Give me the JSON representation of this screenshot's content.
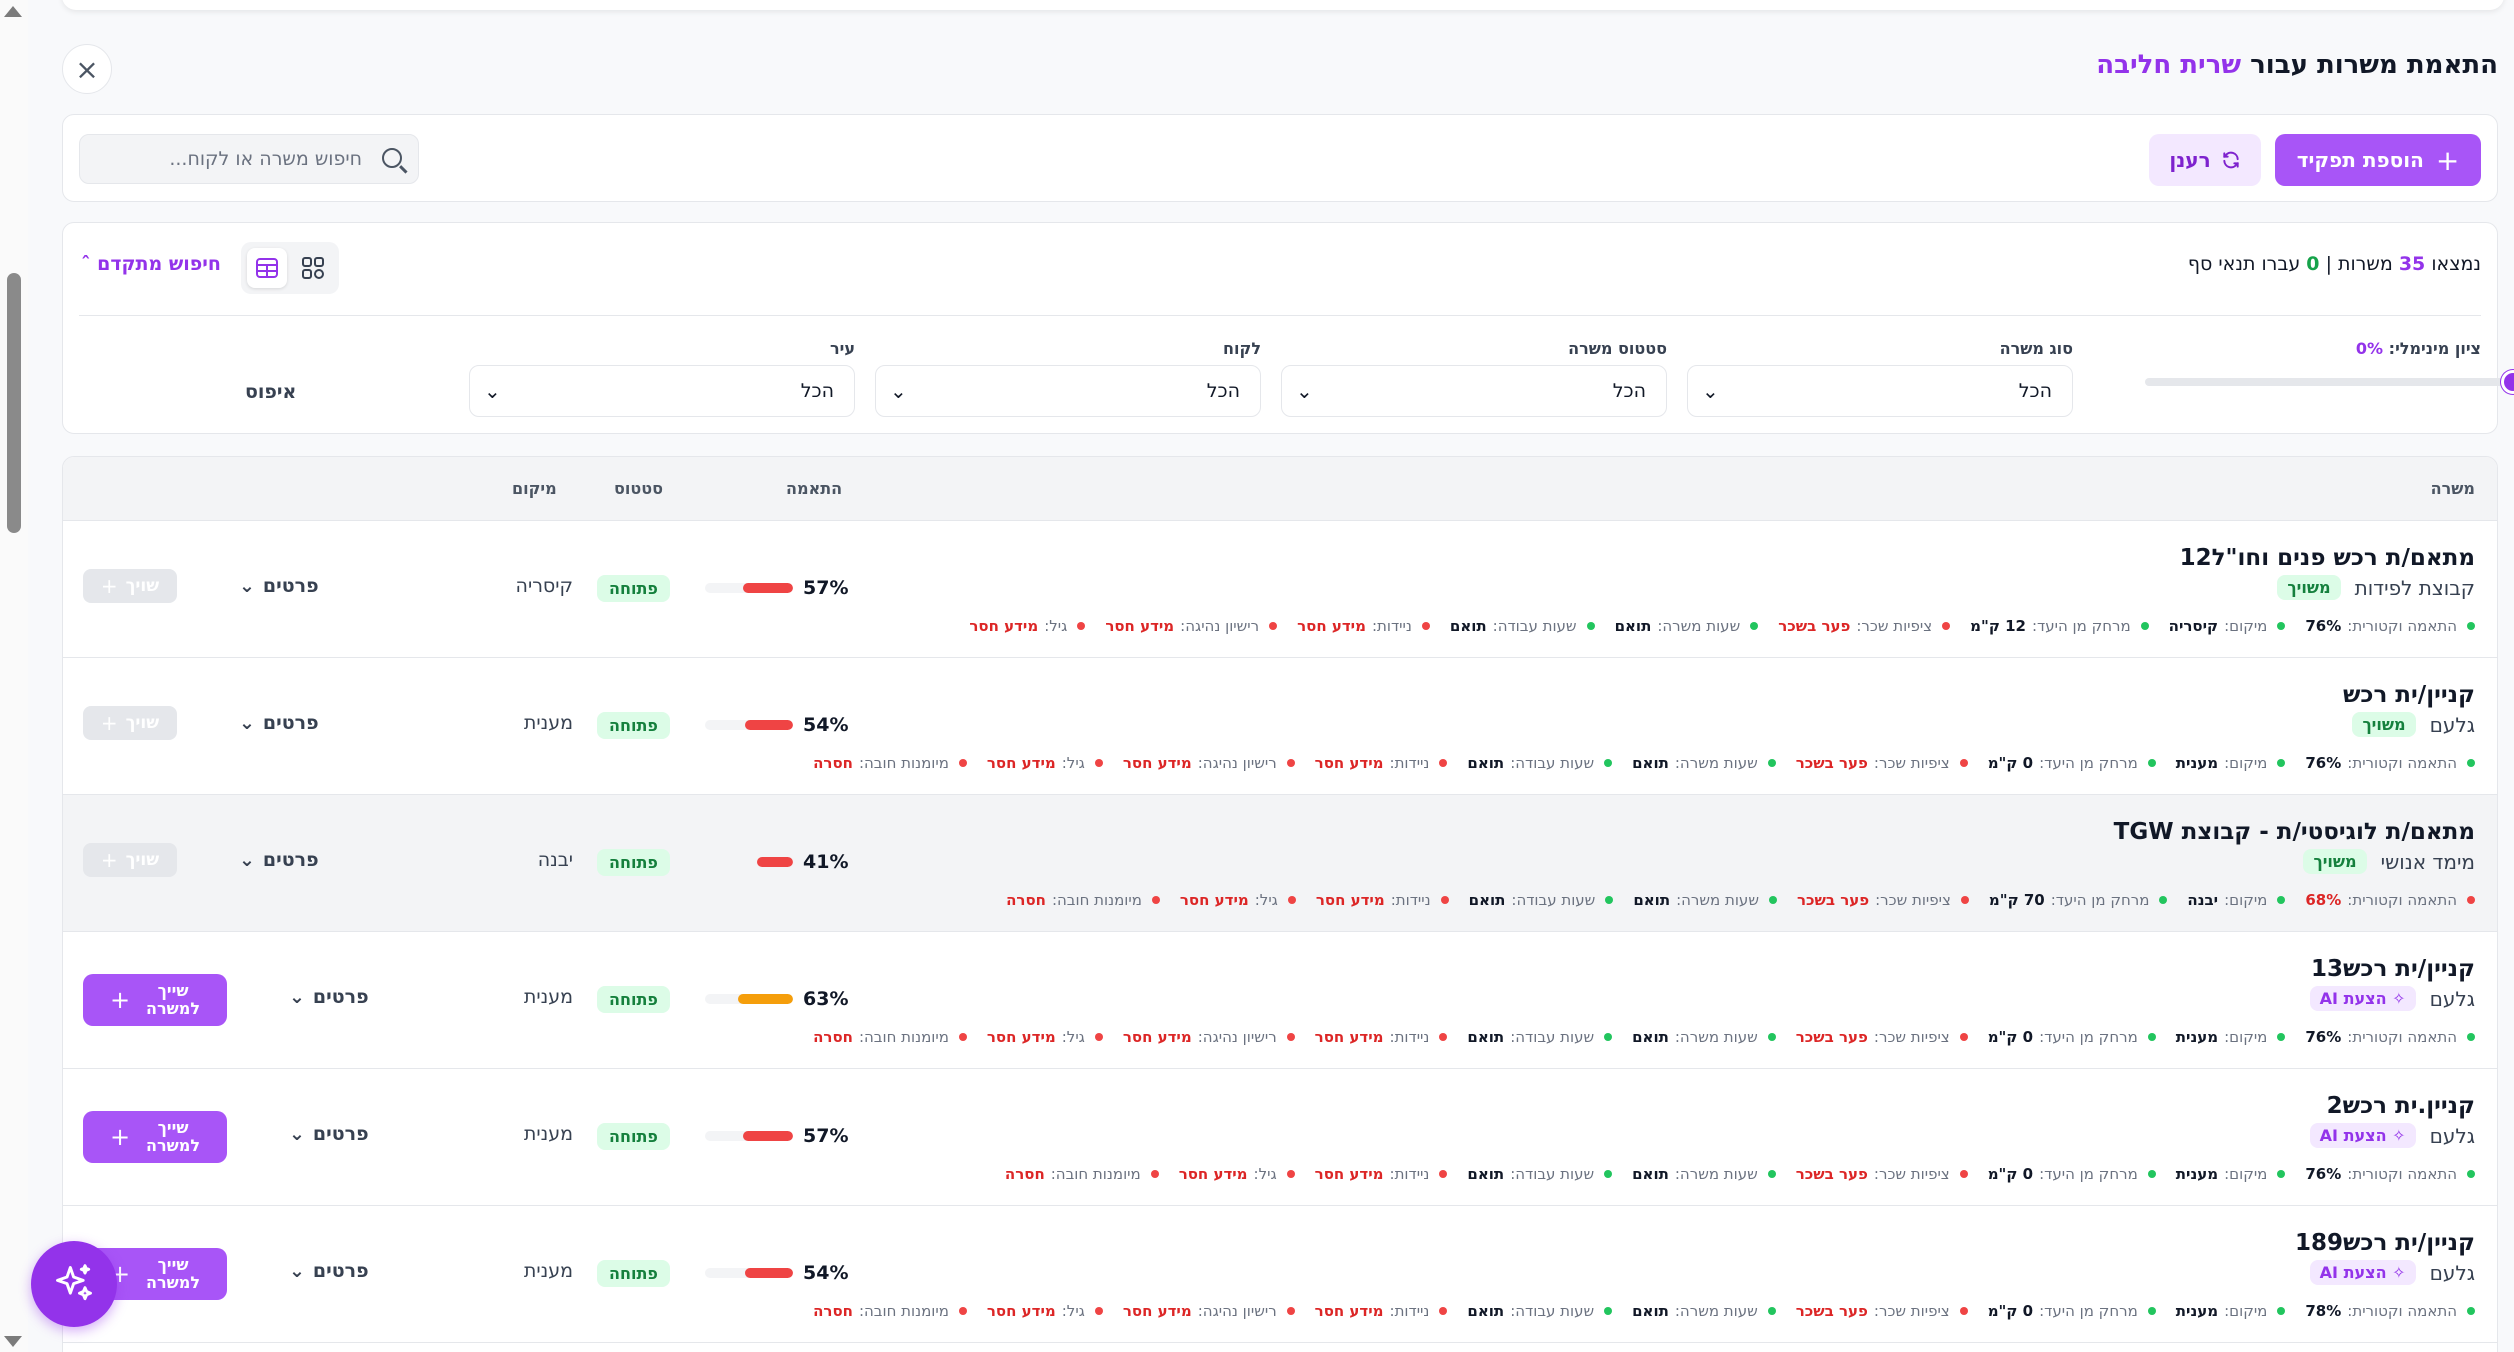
{
  "header": {
    "title_prefix": "התאמת משרות עבור",
    "candidate_name": "שרית חליבה"
  },
  "toolbar": {
    "add_role_label": "הוספת תפקיד",
    "refresh_label": "רענן",
    "search_placeholder": "חיפוש משרה או לקוח..."
  },
  "filters": {
    "found_prefix": "נמצאו",
    "found_count": "35",
    "found_mid": "משרות |",
    "passed_count": "0",
    "passed_suffix": "עברו תנאי סף",
    "advanced_search_label": "חיפוש מתקדם",
    "min_score_label": "ציון מינימלי:",
    "min_score_value": "0%",
    "job_type_label": "סוג משרה",
    "job_status_label": "סטטוס משרה",
    "client_label": "לקוח",
    "city_label": "עיר",
    "all_option": "הכל",
    "reset_label": "איפוס"
  },
  "table": {
    "headers": {
      "job": "משרה",
      "match": "התאמה",
      "status": "סטטוס",
      "location": "מיקום"
    },
    "details_label": "פרטים",
    "assign_label": "שויך",
    "assign_to_job_label_1": "שייך",
    "assign_to_job_label_2": "למשרה",
    "rows": [
      {
        "title": "מתאם/ת רכש פנים וחו\"ל12",
        "client": "קבוצת לפידות",
        "badge": "משויך",
        "match_pct": "57%",
        "match_value": 57,
        "status": "פתוחה",
        "location": "קיסריה",
        "criteria": [
          {
            "label": "התאמה וקטורית:",
            "value": "76%",
            "ok": true
          },
          {
            "label": "מיקום:",
            "value": "קיסריה",
            "ok": true
          },
          {
            "label": "מרחק מן היעד:",
            "value": "12 ק\"מ",
            "ok": true
          },
          {
            "label": "ציפיות שכר:",
            "value": "פער בשכר",
            "ok": false
          },
          {
            "label": "שעות משרה:",
            "value": "תואם",
            "ok": true
          },
          {
            "label": "שעות עבודה:",
            "value": "תואם",
            "ok": true
          },
          {
            "label": "ניידות:",
            "value": "מידע חסר",
            "ok": false
          },
          {
            "label": "רישיון נהיגה:",
            "value": "מידע חסר",
            "ok": false
          },
          {
            "label": "גיל:",
            "value": "מידע חסר",
            "ok": false
          }
        ]
      },
      {
        "title": "קניין/ית רכש",
        "client": "גלעם",
        "badge": "משויך",
        "match_pct": "54%",
        "match_value": 54,
        "status": "פתוחה",
        "location": "מענית",
        "criteria": [
          {
            "label": "התאמה וקטורית:",
            "value": "76%",
            "ok": true
          },
          {
            "label": "מיקום:",
            "value": "מענית",
            "ok": true
          },
          {
            "label": "מרחק מן היעד:",
            "value": "0 ק\"מ",
            "ok": true
          },
          {
            "label": "ציפיות שכר:",
            "value": "פער בשכר",
            "ok": false
          },
          {
            "label": "שעות משרה:",
            "value": "תואם",
            "ok": true
          },
          {
            "label": "שעות עבודה:",
            "value": "תואם",
            "ok": true
          },
          {
            "label": "ניידות:",
            "value": "מידע חסר",
            "ok": false
          },
          {
            "label": "רישיון נהיגה:",
            "value": "מידע חסר",
            "ok": false
          },
          {
            "label": "גיל:",
            "value": "מידע חסר",
            "ok": false
          },
          {
            "label": "מיומנות חובה:",
            "value": "חסרה",
            "ok": false
          }
        ]
      },
      {
        "title": "מתאם/ת לוגיסטי/ת - קבוצת TGW",
        "client": "מימד אנושי",
        "badge": "משויך",
        "match_pct": "41%",
        "match_value": 41,
        "status": "פתוחה",
        "location": "יבנה",
        "criteria": [
          {
            "label": "התאמה וקטורית:",
            "value": "68%",
            "ok": false
          },
          {
            "label": "מיקום:",
            "value": "יבנה",
            "ok": true
          },
          {
            "label": "מרחק מן היעד:",
            "value": "70 ק\"מ",
            "ok": true
          },
          {
            "label": "ציפיות שכר:",
            "value": "פער בשכר",
            "ok": false
          },
          {
            "label": "שעות משרה:",
            "value": "תואם",
            "ok": true
          },
          {
            "label": "שעות עבודה:",
            "value": "תואם",
            "ok": true
          },
          {
            "label": "ניידות:",
            "value": "מידע חסר",
            "ok": false
          },
          {
            "label": "גיל:",
            "value": "מידע חסר",
            "ok": false
          },
          {
            "label": "מיומנות חובה:",
            "value": "חסרה",
            "ok": false
          }
        ]
      },
      {
        "title": "קניין/ית רכש13",
        "client": "גלעם",
        "badge": "הצעת AI",
        "match_pct": "63%",
        "match_value": 63,
        "status": "פתוחה",
        "location": "מענית",
        "criteria": [
          {
            "label": "התאמה וקטורית:",
            "value": "76%",
            "ok": true
          },
          {
            "label": "מיקום:",
            "value": "מענית",
            "ok": true
          },
          {
            "label": "מרחק מן היעד:",
            "value": "0 ק\"מ",
            "ok": true
          },
          {
            "label": "ציפיות שכר:",
            "value": "פער בשכר",
            "ok": false
          },
          {
            "label": "שעות משרה:",
            "value": "תואם",
            "ok": true
          },
          {
            "label": "שעות עבודה:",
            "value": "תואם",
            "ok": true
          },
          {
            "label": "ניידות:",
            "value": "מידע חסר",
            "ok": false
          },
          {
            "label": "רישיון נהיגה:",
            "value": "מידע חסר",
            "ok": false
          },
          {
            "label": "גיל:",
            "value": "מידע חסר",
            "ok": false
          },
          {
            "label": "מיומנות חובה:",
            "value": "חסרה",
            "ok": false
          }
        ]
      },
      {
        "title": "קניין.ית רכש2",
        "client": "גלעם",
        "badge": "הצעת AI",
        "match_pct": "57%",
        "match_value": 57,
        "status": "פתוחה",
        "location": "מענית",
        "criteria": [
          {
            "label": "התאמה וקטורית:",
            "value": "76%",
            "ok": true
          },
          {
            "label": "מיקום:",
            "value": "מענית",
            "ok": true
          },
          {
            "label": "מרחק מן היעד:",
            "value": "0 ק\"מ",
            "ok": true
          },
          {
            "label": "ציפיות שכר:",
            "value": "פער בשכר",
            "ok": false
          },
          {
            "label": "שעות משרה:",
            "value": "תואם",
            "ok": true
          },
          {
            "label": "שעות עבודה:",
            "value": "תואם",
            "ok": true
          },
          {
            "label": "ניידות:",
            "value": "מידע חסר",
            "ok": false
          },
          {
            "label": "גיל:",
            "value": "מידע חסר",
            "ok": false
          },
          {
            "label": "מיומנות חובה:",
            "value": "חסרה",
            "ok": false
          }
        ]
      },
      {
        "title": "קניין/ית רכש189",
        "client": "גלעם",
        "badge": "הצעת AI",
        "match_pct": "54%",
        "match_value": 54,
        "status": "פתוחה",
        "location": "מענית",
        "criteria": [
          {
            "label": "התאמה וקטורית:",
            "value": "78%",
            "ok": true
          },
          {
            "label": "מיקום:",
            "value": "מענית",
            "ok": true
          },
          {
            "label": "מרחק מן היעד:",
            "value": "0 ק\"מ",
            "ok": true
          },
          {
            "label": "ציפיות שכר:",
            "value": "פער בשכר",
            "ok": false
          },
          {
            "label": "שעות משרה:",
            "value": "תואם",
            "ok": true
          },
          {
            "label": "שעות עבודה:",
            "value": "תואם",
            "ok": true
          },
          {
            "label": "ניידות:",
            "value": "מידע חסר",
            "ok": false
          },
          {
            "label": "רישיון נהיגה:",
            "value": "מידע חסר",
            "ok": false
          },
          {
            "label": "גיל:",
            "value": "מידע חסר",
            "ok": false
          },
          {
            "label": "מיומנות חובה:",
            "value": "חסרה",
            "ok": false
          }
        ]
      }
    ]
  },
  "colors": {
    "accent": "#a855f7",
    "bar_red": "#ef4444",
    "bar_orange": "#f59e0b"
  }
}
